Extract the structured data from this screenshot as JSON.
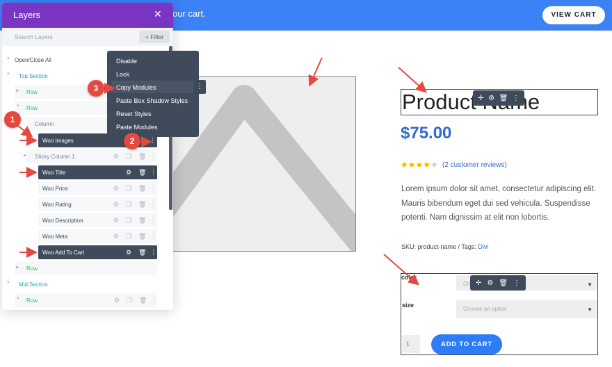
{
  "notice": {
    "text": "our cart.",
    "button": "VIEW CART"
  },
  "product": {
    "title": "Product Name",
    "price": "$75.00",
    "rating": 4,
    "reviews_link": "(2 customer reviews)",
    "description": "Lorem ipsum dolor sit amet, consectetur adipiscing elit. Mauris bibendum eget dui sed vehicula. Suspendisse potenti. Nam dignissim at elit non lobortis.",
    "meta_prefix": "SKU: product-name / Tags: ",
    "meta_tag": "Divi",
    "form": {
      "color_label": "color",
      "size_label": "size",
      "select_partial": "Cho",
      "select_placeholder": "Choose an option",
      "quantity": "1",
      "add_to_cart": "ADD TO CART"
    }
  },
  "layers": {
    "title": "Layers",
    "search_placeholder": "Search Layers",
    "filter_label": "+ Filter",
    "open_close": "Open/Close All",
    "items": [
      {
        "label": "Top Section"
      },
      {
        "label": "Row"
      },
      {
        "label": "Row"
      },
      {
        "label": "Column"
      },
      {
        "label": "Woo Images"
      },
      {
        "label": "Sticky Column 1"
      },
      {
        "label": "Woo Title"
      },
      {
        "label": "Woo Price"
      },
      {
        "label": "Woo Rating"
      },
      {
        "label": "Woo Description"
      },
      {
        "label": "Woo Meta"
      },
      {
        "label": "Woo Add To Cart"
      },
      {
        "label": "Row"
      },
      {
        "label": "Mid Section"
      },
      {
        "label": "Row"
      }
    ]
  },
  "context_menu": {
    "items": [
      "Disable",
      "Lock",
      "Copy Modules",
      "Paste Box Shadow Styles",
      "Reset Styles",
      "Paste Modules"
    ],
    "highlighted": "Copy Modules"
  },
  "callouts": [
    "1",
    "2",
    "3"
  ],
  "colors": {
    "accent_blue": "#3b82f6",
    "layers_header": "#7a35c2",
    "dark_toolbar": "#3f4a5a",
    "callout_red": "#e5483f",
    "price_blue": "#2f6ad1",
    "star": "#f0b400"
  },
  "icons": [
    "close-icon",
    "move-icon",
    "gear-icon",
    "duplicate-icon",
    "trash-icon",
    "more-icon",
    "triangle-icon",
    "chevron-down-icon",
    "star-icon"
  ]
}
